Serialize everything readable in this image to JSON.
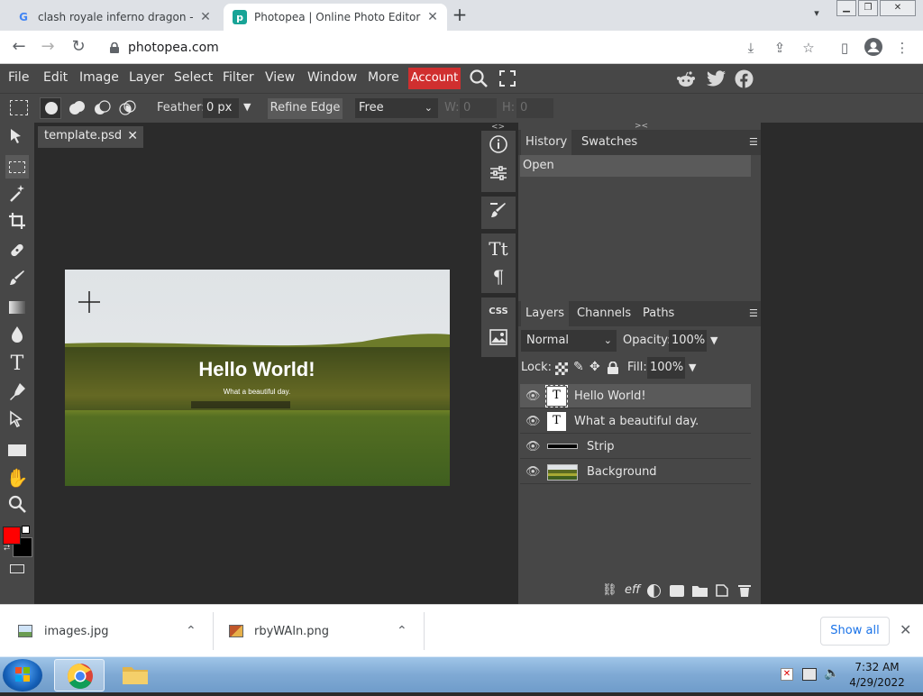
{
  "browser": {
    "tabs": [
      {
        "title": "clash royale inferno dragon - Go",
        "favicon": "google-g-icon"
      },
      {
        "title": "Photopea | Online Photo Editor",
        "favicon": "photopea-icon"
      }
    ],
    "url": "photopea.com"
  },
  "app": {
    "menu": [
      "File",
      "Edit",
      "Image",
      "Layer",
      "Select",
      "Filter",
      "View",
      "Window",
      "More"
    ],
    "account_label": "Account",
    "accent_color": "#d02f2f"
  },
  "options": {
    "feather_label": "Feather:",
    "feather_value": "0 px",
    "refine_edge_label": "Refine Edge",
    "style_value": "Free",
    "w_label": "W:",
    "w_value": "0",
    "h_label": "H:",
    "h_value": "0"
  },
  "document": {
    "tab_title": "template.psd",
    "canvas_title": "Hello World!",
    "canvas_subtitle": "What a beautiful day."
  },
  "history_panel": {
    "tabs": [
      "History",
      "Swatches"
    ],
    "items": [
      "Open"
    ]
  },
  "layers_panel": {
    "tabs": [
      "Layers",
      "Channels",
      "Paths"
    ],
    "blend_mode": "Normal",
    "opacity_label": "Opacity:",
    "opacity_value": "100%",
    "lock_label": "Lock:",
    "fill_label": "Fill:",
    "fill_value": "100%",
    "layers": [
      {
        "name": "Hello World!",
        "type": "text"
      },
      {
        "name": "What a beautiful day.",
        "type": "text"
      },
      {
        "name": "Strip",
        "type": "shape"
      },
      {
        "name": "Background",
        "type": "image"
      }
    ]
  },
  "downloads": {
    "items": [
      "images.jpg",
      "rbyWAln.png"
    ],
    "show_all_label": "Show all"
  },
  "taskbar": {
    "time": "7:32 AM",
    "date": "4/29/2022"
  }
}
